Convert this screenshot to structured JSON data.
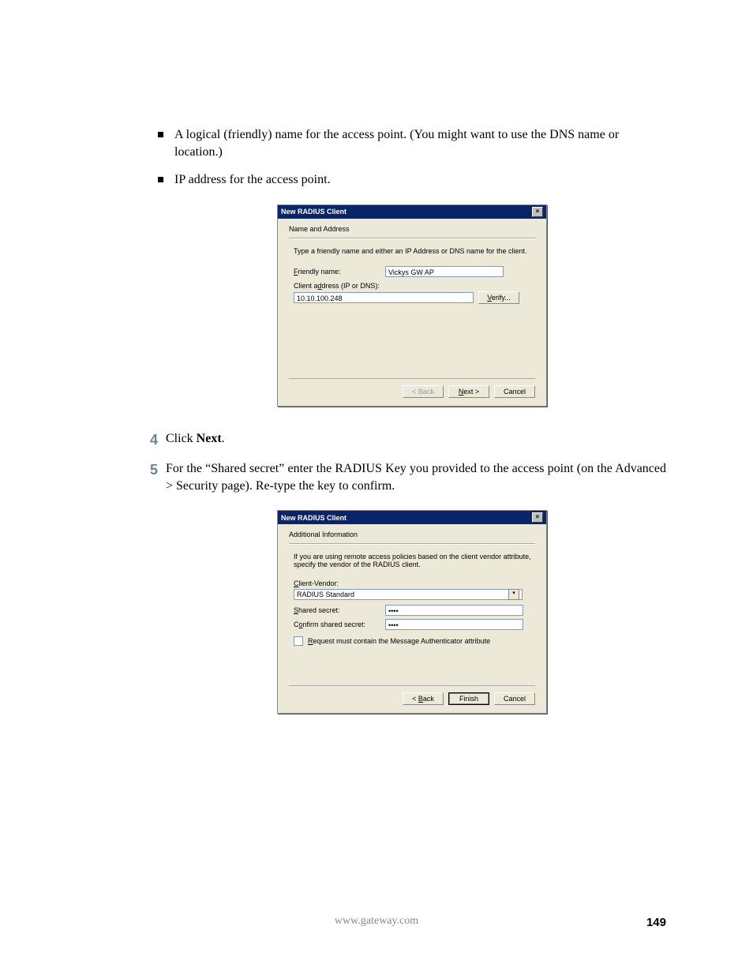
{
  "bullets": {
    "b1": "A logical (friendly) name for the access point. (You might want to use the DNS name or location.)",
    "b2": "IP address for the access point."
  },
  "steps": {
    "s4": {
      "num": "4",
      "prefix": "Click ",
      "bold": "Next",
      "suffix": "."
    },
    "s5": {
      "num": "5",
      "text": "For the “Shared secret” enter the RADIUS Key you provided to the access point (on the Advanced > Security page). Re-type the key to confirm."
    }
  },
  "dialog1": {
    "title": "New RADIUS Client",
    "subtitle": "Name and Address",
    "desc": "Type a friendly name and either an IP Address or DNS name for the client.",
    "friendly_label": "Friendly name:",
    "friendly_value": "Vickys GW AP",
    "addr_label": "Client address (IP or DNS):",
    "addr_value": "10.10.100.248",
    "verify": "Verify...",
    "back": "< Back",
    "next": "Next >",
    "cancel": "Cancel"
  },
  "dialog2": {
    "title": "New RADIUS Client",
    "subtitle": "Additional Information",
    "desc": "If you are using remote access policies based on the client vendor attribute, specify the vendor of the RADIUS client.",
    "vendor_label": "Client-Vendor:",
    "vendor_value": "RADIUS Standard",
    "secret_label": "Shared secret:",
    "secret_value": "••••",
    "confirm_label": "Confirm shared secret:",
    "confirm_value": "••••",
    "checkbox_label": "Request must contain the Message Authenticator attribute",
    "back": "< Back",
    "finish": "Finish",
    "cancel": "Cancel"
  },
  "footer": {
    "url": "www.gateway.com",
    "page": "149"
  }
}
